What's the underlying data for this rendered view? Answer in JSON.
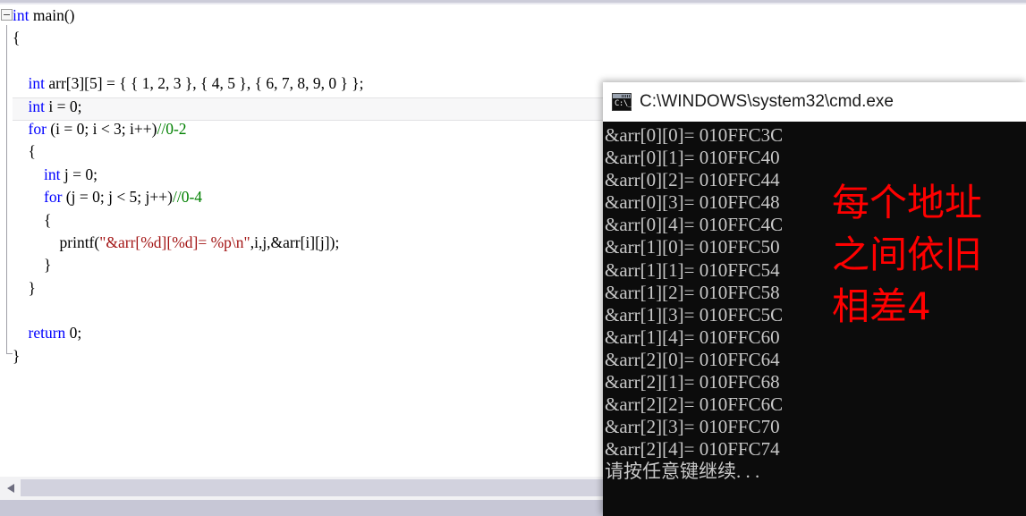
{
  "editor": {
    "name": "code-editor",
    "language": "c",
    "current_line_text": "    int i = 0;",
    "code_lines": [
      {
        "indent": 0,
        "segments": [
          {
            "t": "int",
            "c": "kw"
          },
          {
            "t": " main()",
            "c": "plain"
          }
        ]
      },
      {
        "indent": 0,
        "segments": [
          {
            "t": "{",
            "c": "plain"
          }
        ]
      },
      {
        "indent": 0,
        "segments": [
          {
            "t": "",
            "c": "plain"
          }
        ]
      },
      {
        "indent": 0,
        "segments": [
          {
            "t": "    ",
            "c": "plain"
          },
          {
            "t": "int",
            "c": "kw"
          },
          {
            "t": " arr[3][5] = { { 1, 2, 3 }, { 4, 5 }, { 6, 7, 8, 9, 0 } };",
            "c": "plain"
          }
        ]
      },
      {
        "indent": 0,
        "segments": [
          {
            "t": "    ",
            "c": "plain"
          },
          {
            "t": "int",
            "c": "kw"
          },
          {
            "t": " i = 0;",
            "c": "plain"
          }
        ]
      },
      {
        "indent": 0,
        "segments": [
          {
            "t": "    ",
            "c": "plain"
          },
          {
            "t": "for",
            "c": "kw"
          },
          {
            "t": " (i = 0; i < 3; i++)",
            "c": "plain"
          },
          {
            "t": "//0-2",
            "c": "cmt"
          }
        ]
      },
      {
        "indent": 0,
        "segments": [
          {
            "t": "    {",
            "c": "plain"
          }
        ]
      },
      {
        "indent": 0,
        "segments": [
          {
            "t": "        ",
            "c": "plain"
          },
          {
            "t": "int",
            "c": "kw"
          },
          {
            "t": " j = 0;",
            "c": "plain"
          }
        ]
      },
      {
        "indent": 0,
        "segments": [
          {
            "t": "        ",
            "c": "plain"
          },
          {
            "t": "for",
            "c": "kw"
          },
          {
            "t": " (j = 0; j < 5; j++)",
            "c": "plain"
          },
          {
            "t": "//0-4",
            "c": "cmt"
          }
        ]
      },
      {
        "indent": 0,
        "segments": [
          {
            "t": "        {",
            "c": "plain"
          }
        ]
      },
      {
        "indent": 0,
        "segments": [
          {
            "t": "            printf(",
            "c": "plain"
          },
          {
            "t": "\"&arr[%d][%d]= %p\\n\"",
            "c": "str"
          },
          {
            "t": ",i,j,&arr[i][j]);",
            "c": "plain"
          }
        ]
      },
      {
        "indent": 0,
        "segments": [
          {
            "t": "        }",
            "c": "plain"
          }
        ]
      },
      {
        "indent": 0,
        "segments": [
          {
            "t": "    }",
            "c": "plain"
          }
        ]
      },
      {
        "indent": 0,
        "segments": [
          {
            "t": "",
            "c": "plain"
          }
        ]
      },
      {
        "indent": 0,
        "segments": [
          {
            "t": "    ",
            "c": "plain"
          },
          {
            "t": "return",
            "c": "kw"
          },
          {
            "t": " 0;",
            "c": "plain"
          }
        ]
      },
      {
        "indent": 0,
        "segments": [
          {
            "t": "}",
            "c": "plain"
          }
        ]
      }
    ],
    "outline_toggle": "collapse-minus",
    "colors": {
      "keyword": "#0000ff",
      "comment": "#008000",
      "string": "#a31515",
      "text": "#000000",
      "background": "#ffffff"
    }
  },
  "scrollbar": {
    "left_arrow_icon": "triangle-left-icon",
    "orientation": "horizontal"
  },
  "console": {
    "title": "C:\\WINDOWS\\system32\\cmd.exe",
    "icon": "cmd-exe-icon",
    "icon_prompt": "C:\\_",
    "background": "#0c0c0c",
    "foreground": "#c8c8c8",
    "lines": [
      "&arr[0][0]= 010FFC3C",
      "&arr[0][1]= 010FFC40",
      "&arr[0][2]= 010FFC44",
      "&arr[0][3]= 010FFC48",
      "&arr[0][4]= 010FFC4C",
      "&arr[1][0]= 010FFC50",
      "&arr[1][1]= 010FFC54",
      "&arr[1][2]= 010FFC58",
      "&arr[1][3]= 010FFC5C",
      "&arr[1][4]= 010FFC60",
      "&arr[2][0]= 010FFC64",
      "&arr[2][1]= 010FFC68",
      "&arr[2][2]= 010FFC6C",
      "&arr[2][3]= 010FFC70",
      "&arr[2][4]= 010FFC74",
      "请按任意键继续. . ."
    ]
  },
  "annotation": {
    "color": "#ff0000",
    "lines": [
      "每个地址",
      "之间依旧",
      "相差4"
    ]
  }
}
